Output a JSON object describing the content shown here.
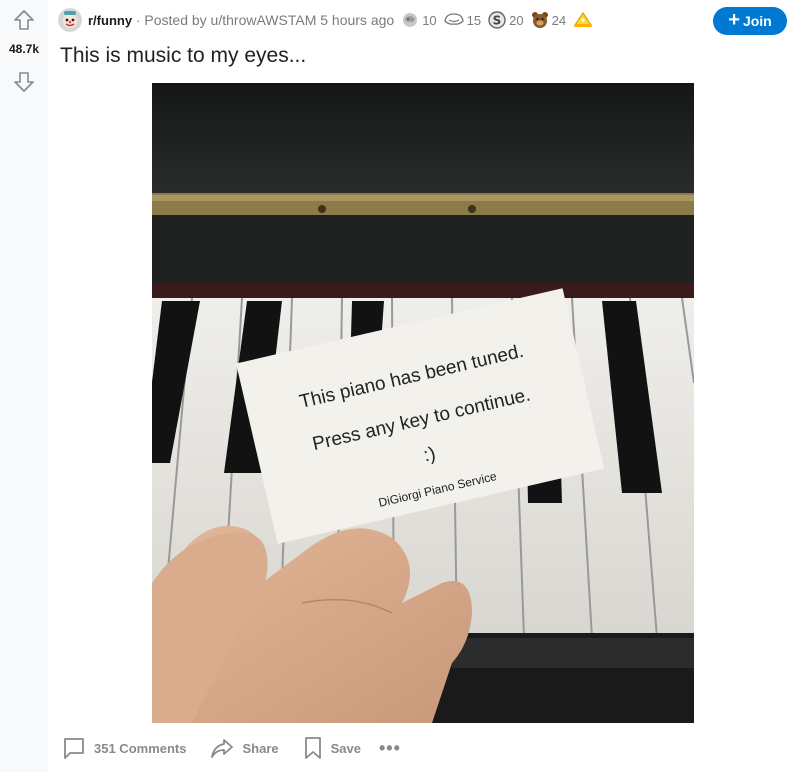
{
  "post": {
    "score": "48.7k",
    "subreddit": "r/funny",
    "posted_by": "Posted by u/throwAWSTAM 5 hours ago",
    "awards": [
      {
        "icon": "silver-award-icon",
        "count": "10"
      },
      {
        "icon": "helpful-award-icon",
        "count": "15"
      },
      {
        "icon": "coin-award-icon",
        "count": "20"
      },
      {
        "icon": "bear-award-icon",
        "count": "24"
      },
      {
        "icon": "hat-award-icon",
        "count": ""
      }
    ],
    "join_label": "Join",
    "title": "This is music to my eyes..."
  },
  "card": {
    "line1": "This piano has been tuned.",
    "line2": "Press any key to continue.",
    "line3": ":)",
    "line4": "DiGiorgi Piano Service"
  },
  "footer": {
    "comments_label": "351 Comments",
    "share_label": "Share",
    "save_label": "Save",
    "more_label": "•••"
  },
  "colors": {
    "join": "#0079d3",
    "vote_col": "#f8f9fa",
    "meta_text": "#787c7e"
  }
}
